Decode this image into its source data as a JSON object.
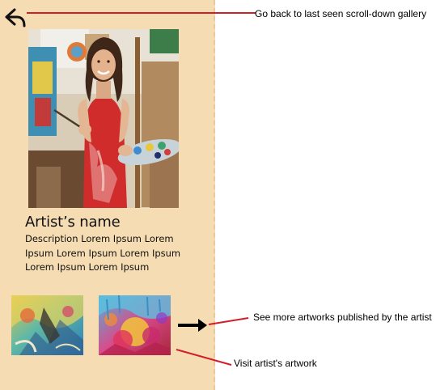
{
  "artist": {
    "name": "Artist’s name",
    "description": "Description Lorem Ipsum Lorem Ipsum Lorem Ipsum Lorem Ipsum Lorem Ipsum Lorem Ipsum"
  },
  "annotations": {
    "back": "Go back to last seen scroll-down gallery",
    "more": "See more artworks published by the artist",
    "visit": "Visit artist's artwork"
  },
  "icons": {
    "back": "back-arrow-icon",
    "more": "right-arrow-icon"
  },
  "colors": {
    "panel_bg": "#f6dcb2",
    "annotation_line": "#d11f2a"
  }
}
